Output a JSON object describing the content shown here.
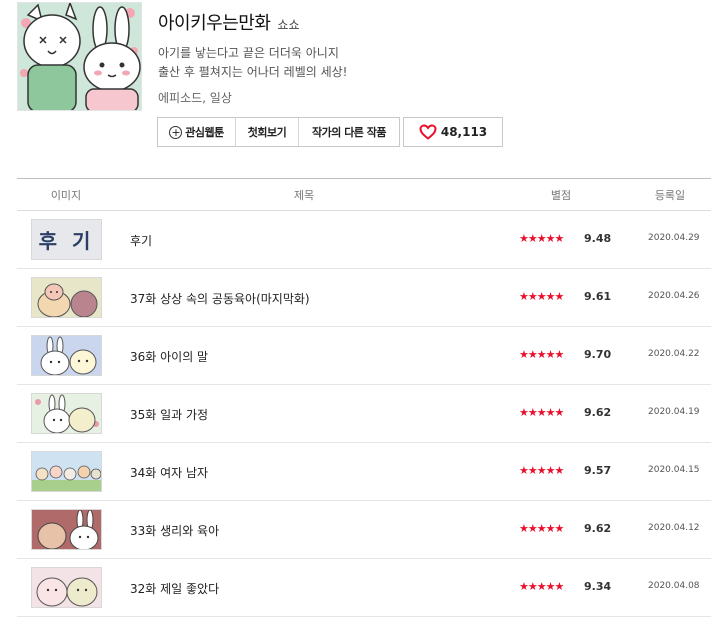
{
  "webtoon": {
    "title": "아이키우는만화",
    "author": "쇼쇼",
    "description_line1": "아기를 낳는다고 끝은 더더욱 아니지",
    "description_line2": "출산 후 펼쳐지는 어나더 레벨의 세상!",
    "genre": "에피소드, 일상"
  },
  "actions": {
    "favorite_label": "관심웹툰",
    "first_episode_label": "첫회보기",
    "author_works_label": "작가의 다른 작품",
    "like_count": "48,113"
  },
  "table": {
    "headers": {
      "image": "이미지",
      "title": "제목",
      "rating": "별점",
      "date": "등록일"
    }
  },
  "episodes": [
    {
      "title": "후기",
      "rating": "9.48",
      "date": "2020.04.29",
      "thumb_text": "후 기"
    },
    {
      "title": "37화 상상 속의 공동육아(마지막화)",
      "rating": "9.61",
      "date": "2020.04.26"
    },
    {
      "title": "36화 아이의 말",
      "rating": "9.70",
      "date": "2020.04.22"
    },
    {
      "title": "35화 일과 가정",
      "rating": "9.62",
      "date": "2020.04.19"
    },
    {
      "title": "34화 여자 남자",
      "rating": "9.57",
      "date": "2020.04.15"
    },
    {
      "title": "33화 생리와 육아",
      "rating": "9.62",
      "date": "2020.04.12"
    },
    {
      "title": "32화 제일 좋았다",
      "rating": "9.34",
      "date": "2020.04.08"
    }
  ],
  "colors": {
    "star": "#e8112d",
    "heart": "#e8112d",
    "thumb_bg": "#cfe7da"
  },
  "icons": {
    "favorite": "plus-circle-icon",
    "like": "heart-icon",
    "rating": "star-icon"
  }
}
